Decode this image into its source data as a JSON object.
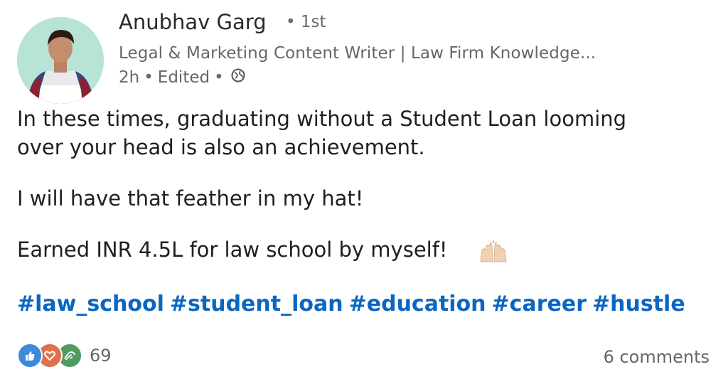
{
  "author": {
    "name": "Anubhav Garg",
    "separator": "•",
    "degree": "1st",
    "headline": "Legal & Marketing Content Writer | Law Firm Knowledge...",
    "time": "2h",
    "edited": "Edited",
    "visibility_icon": "globe-icon"
  },
  "post": {
    "lines": [
      "In these times, graduating without a Student Loan looming",
      "over your head is also an achievement.",
      "I will have that feather in my hat!",
      "Earned INR 4.5L for law school by myself!"
    ],
    "emoji": "raising-hands-icon",
    "hashtags": [
      "#law_school",
      "#student_loan",
      "#education",
      "#career",
      "#hustle"
    ]
  },
  "social": {
    "reaction_icons": [
      "like-icon",
      "love-icon",
      "celebrate-icon"
    ],
    "reaction_count": "69",
    "comments": "6 comments"
  },
  "colors": {
    "hashtag": "#0a66c2",
    "like": "#3b8bd9",
    "love": "#df704d",
    "celebrate": "#4f9b62"
  }
}
